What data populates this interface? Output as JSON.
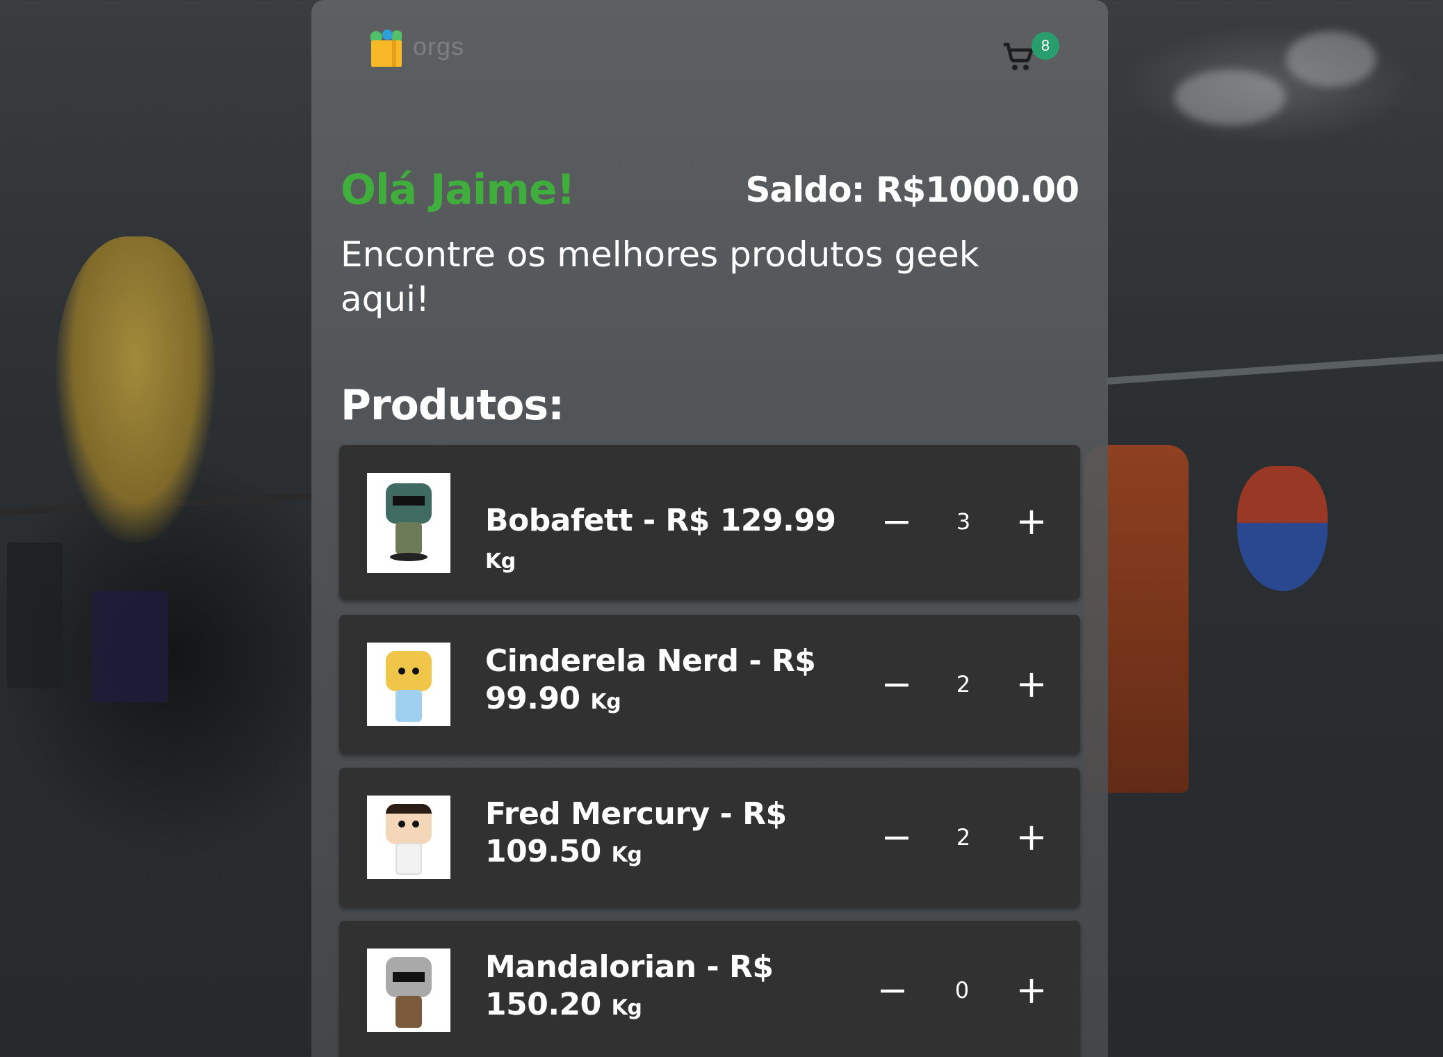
{
  "brand": {
    "logo_text": "orgs",
    "logo_icon": "grocery-bag-icon"
  },
  "cart": {
    "icon": "cart-icon",
    "count": "8",
    "badge_color": "#2a9d6c"
  },
  "greeting": "Olá Jaime!",
  "balance": "Saldo: R$1000.00",
  "subtitle": "Encontre os melhores produtos geek aqui!",
  "section_title": "Produtos:",
  "colors": {
    "accent_green": "#3fae3c",
    "card_bg": "#313131"
  },
  "products": [
    {
      "name": "Bobafett - R$ 129.99",
      "unit": "Kg",
      "quantity": "3",
      "minus": "−",
      "plus": "+",
      "image": "bobafett-funko-image"
    },
    {
      "name": "Cinderela Nerd - R$ 99.90",
      "unit": "Kg",
      "quantity": "2",
      "minus": "−",
      "plus": "+",
      "image": "cinderela-nerd-funko-image"
    },
    {
      "name": "Fred Mercury - R$ 109.50",
      "unit": "Kg",
      "quantity": "2",
      "minus": "−",
      "plus": "+",
      "image": "fred-mercury-funko-image"
    },
    {
      "name": "Mandalorian - R$ 150.20",
      "unit": "Kg",
      "quantity": "0",
      "minus": "−",
      "plus": "+",
      "image": "mandalorian-funko-image"
    }
  ]
}
